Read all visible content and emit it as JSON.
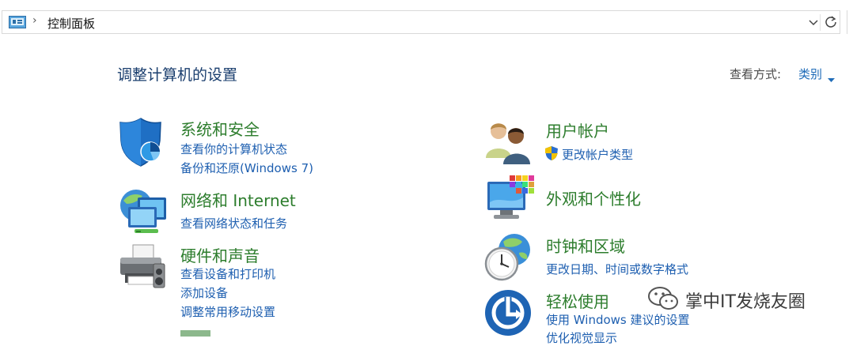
{
  "address_bar": {
    "breadcrumb": "控制面板",
    "separator": "›"
  },
  "page": {
    "title": "调整计算机的设置",
    "view_by_label": "查看方式:",
    "view_by_value": "类别"
  },
  "categories": [
    {
      "title": "系统和安全",
      "links": [
        "查看你的计算机状态",
        "备份和还原(Windows 7)"
      ],
      "icon": "shield-icon"
    },
    {
      "title": "网络和 Internet",
      "links": [
        "查看网络状态和任务"
      ],
      "icon": "network-icon"
    },
    {
      "title": "硬件和声音",
      "links": [
        "查看设备和打印机",
        "添加设备",
        "调整常用移动设置"
      ],
      "icon": "printer-icon"
    },
    {
      "title": "用户帐户",
      "links": [
        "更改帐户类型"
      ],
      "icon": "users-icon"
    },
    {
      "title": "外观和个性化",
      "links": [],
      "icon": "monitor-palette-icon"
    },
    {
      "title": "时钟和区域",
      "links": [
        "更改日期、时间或数字格式"
      ],
      "icon": "clock-globe-icon"
    },
    {
      "title": "轻松使用",
      "links": [
        "使用 Windows 建议的设置",
        "优化视觉显示"
      ],
      "icon": "ease-of-access-icon"
    }
  ],
  "watermark": {
    "text": "掌中IT发烧友圈",
    "icon": "wechat-icon"
  },
  "colors": {
    "category_title": "#2d7d2d",
    "link": "#1e5fb0",
    "page_title": "#1a3e6e",
    "accent_blue": "#1e6bb8"
  }
}
